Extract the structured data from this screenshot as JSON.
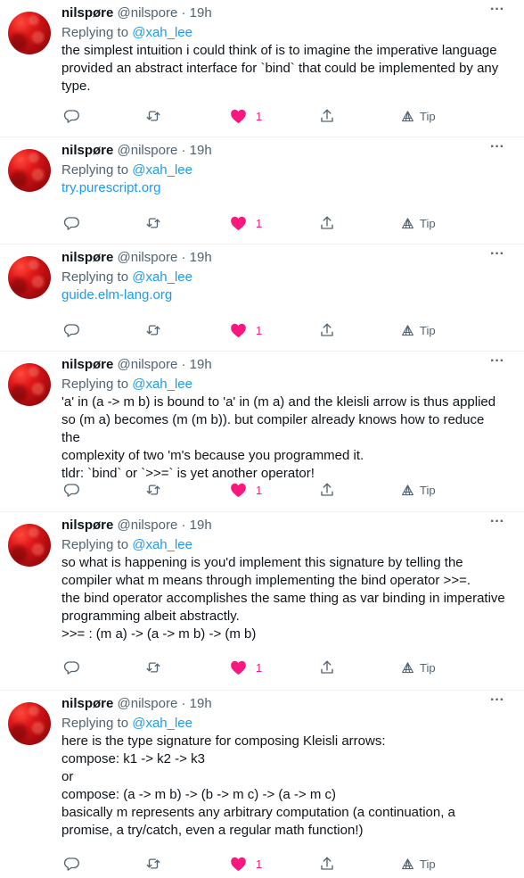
{
  "tweets": [
    {
      "name": "nilspøre",
      "handle": "@nilspore",
      "dot": "·",
      "time": "19h",
      "replying_prefix": "Replying to ",
      "replying_to": "@xah_lee",
      "text": "the simplest intuition i could think of is to imagine the imperative language\nprovided an abstract interface for `bind` that could be implemented by any\ntype.",
      "is_link": false,
      "likes": "1",
      "tip_label": "Tip"
    },
    {
      "name": "nilspøre",
      "handle": "@nilspore",
      "dot": "·",
      "time": "19h",
      "replying_prefix": "Replying to ",
      "replying_to": "@xah_lee",
      "text": "try.purescript.org",
      "is_link": true,
      "likes": "1",
      "tip_label": "Tip"
    },
    {
      "name": "nilspøre",
      "handle": "@nilspore",
      "dot": "·",
      "time": "19h",
      "replying_prefix": "Replying to ",
      "replying_to": "@xah_lee",
      "text": "guide.elm-lang.org",
      "is_link": true,
      "likes": "1",
      "tip_label": "Tip"
    },
    {
      "name": "nilspøre",
      "handle": "@nilspore",
      "dot": "·",
      "time": "19h",
      "replying_prefix": "Replying to ",
      "replying_to": "@xah_lee",
      "text": "'a' in (a -> m b) is bound to 'a' in (m a) and the kleisli arrow is thus applied\nso (m a) becomes (m (m b)). but compiler already knows how to reduce the\ncomplexity of two 'm's because you programmed it.\ntldr: `bind` or `>>=` is yet another operator!",
      "is_link": false,
      "likes": "1",
      "tip_label": "Tip"
    },
    {
      "name": "nilspøre",
      "handle": "@nilspore",
      "dot": "·",
      "time": "19h",
      "replying_prefix": "Replying to ",
      "replying_to": "@xah_lee",
      "text": "so what is happening is you'd implement this signature by telling the\ncompiler what m means through implementing the bind operator >>=.\nthe bind operator accomplishes the same thing as var binding in imperative\nprogramming albeit abstractly.\n>>= : (m a) -> (a -> m b) -> (m b)",
      "is_link": false,
      "likes": "1",
      "tip_label": "Tip"
    },
    {
      "name": "nilspøre",
      "handle": "@nilspore",
      "dot": "·",
      "time": "19h",
      "replying_prefix": "Replying to ",
      "replying_to": "@xah_lee",
      "text": "here is the type signature for composing Kleisli arrows:\ncompose: k1 -> k2 -> k3\nor\ncompose: (a -> m b) -> (b -> m c) -> (a -> m c)\nbasically m represents any arbitrary computation (a continuation, a\npromise, a try/catch, even a regular math function!)",
      "is_link": false,
      "likes": "1",
      "tip_label": "Tip"
    }
  ],
  "icons": {
    "more": "more-icon",
    "reply": "reply-icon",
    "retweet": "retweet-icon",
    "like": "heart-icon",
    "share": "share-icon",
    "tip": "tip-icon"
  },
  "colors": {
    "accent": "#1d9bf0",
    "like": "#f91880",
    "muted": "#536471",
    "text": "#0f1419"
  }
}
